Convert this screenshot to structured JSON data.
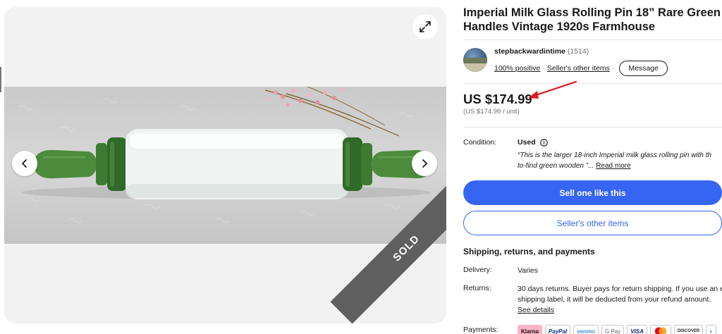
{
  "gallery": {
    "sold_label": "SOLD"
  },
  "listing": {
    "title": "Imperial Milk Glass Rolling Pin 18” Rare Green Handles Vintage 1920s Farmhouse"
  },
  "seller": {
    "name": "stepbackwardintime",
    "feedback_count": "(1514)",
    "positive": "100% positive",
    "separator": "·",
    "other_items_link": "Seller's other items",
    "message_button": "Message"
  },
  "price": {
    "main": "US $174.99",
    "unit": "(US $174.99 / unit)"
  },
  "condition": {
    "label": "Condition:",
    "value": "Used",
    "description": "“This is the larger 18-inch Imperial milk glass rolling pin with th",
    "description_line2": "to-find green wooden ”...",
    "read_more": "Read more"
  },
  "actions": {
    "primary": "Sell one like this",
    "secondary": "Seller's other items"
  },
  "shipping": {
    "heading": "Shipping, returns, and payments",
    "delivery_label": "Delivery:",
    "delivery_value": "Varies",
    "returns_label": "Returns:",
    "returns_line1": "30 days returns. Buyer pays for return shipping. If you use an e",
    "returns_line2": "shipping label, it will be deducted from your refund amount.",
    "see_details": "See details",
    "payments_label": "Payments:",
    "payment_methods": [
      "Klarna",
      "PayPal",
      "venmo",
      "G Pay",
      "VISA",
      "",
      "DISCOVER",
      "◐"
    ]
  },
  "colors": {
    "accent": "#3665f3",
    "arrow": "#e0191f",
    "sold_ribbon": "#5f5f5f"
  }
}
